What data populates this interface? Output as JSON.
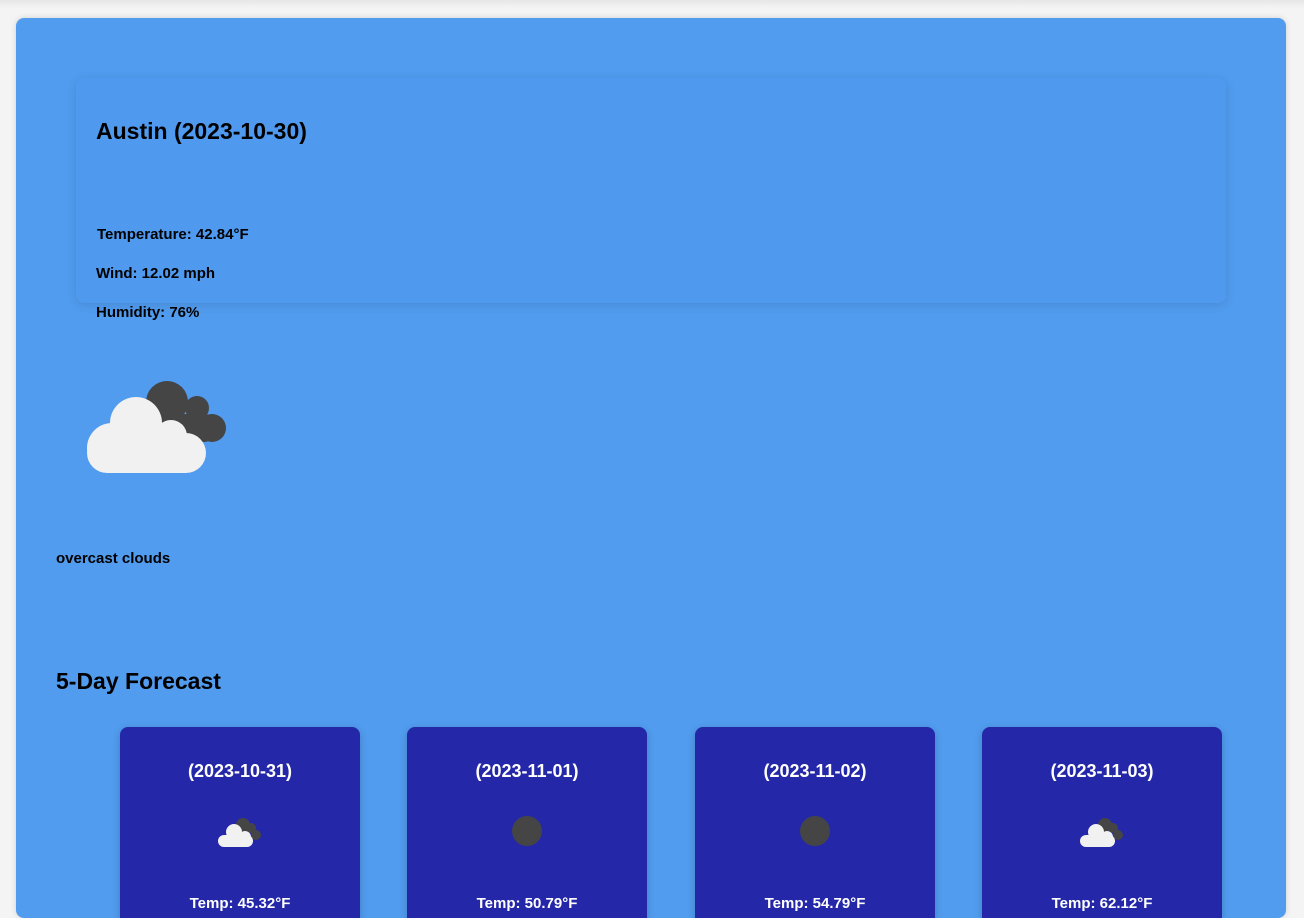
{
  "current": {
    "title": "Austin (2023-10-30)",
    "temperature": "Temperature: 42.84°F",
    "wind": "Wind: 12.02 mph",
    "humidity": "Humidity: 76%",
    "icon": "overcast-clouds-icon",
    "description": "overcast clouds"
  },
  "forecast": {
    "heading": "5-Day Forecast",
    "days": [
      {
        "date": "(2023-10-31)",
        "icon": "broken-clouds-icon",
        "temp": "Temp: 45.32°F"
      },
      {
        "date": "(2023-11-01)",
        "icon": "dark-circle-icon",
        "temp": "Temp: 50.79°F"
      },
      {
        "date": "(2023-11-02)",
        "icon": "dark-circle-icon",
        "temp": "Temp: 54.79°F"
      },
      {
        "date": "(2023-11-03)",
        "icon": "broken-clouds-icon",
        "temp": "Temp: 62.12°F"
      }
    ]
  },
  "colors": {
    "panel": "#519cef",
    "forecast_card": "#2327a8",
    "cloud_light": "#f1f1f1",
    "cloud_dark": "#454545"
  }
}
